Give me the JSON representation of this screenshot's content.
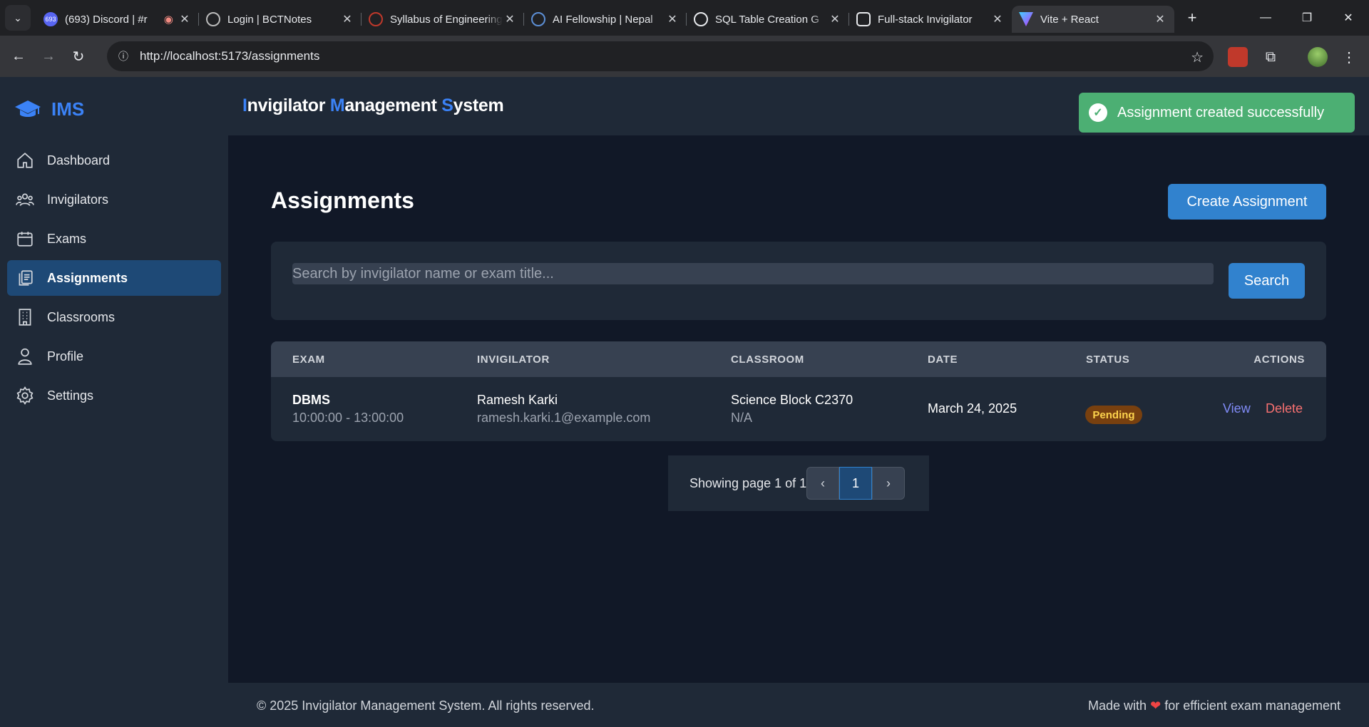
{
  "browser": {
    "tabs": [
      {
        "title": "(693) Discord | #r",
        "badge": "693",
        "active": false
      },
      {
        "title": "Login | BCTNotes",
        "active": false
      },
      {
        "title": "Syllabus of Engineering",
        "active": false
      },
      {
        "title": "AI Fellowship | Nepal",
        "active": false
      },
      {
        "title": "SQL Table Creation G",
        "active": false
      },
      {
        "title": "Full-stack Invigilator",
        "active": false
      },
      {
        "title": "Vite + React",
        "active": true
      }
    ],
    "url": "http://localhost:5173/assignments"
  },
  "sidebar": {
    "logo": "IMS",
    "items": [
      {
        "label": "Dashboard",
        "icon": "home-icon"
      },
      {
        "label": "Invigilators",
        "icon": "users-icon"
      },
      {
        "label": "Exams",
        "icon": "calendar-icon"
      },
      {
        "label": "Assignments",
        "icon": "clipboard-icon"
      },
      {
        "label": "Classrooms",
        "icon": "building-icon"
      },
      {
        "label": "Profile",
        "icon": "user-icon"
      },
      {
        "label": "Settings",
        "icon": "gear-icon"
      }
    ],
    "active_item": "Assignments"
  },
  "header": {
    "title_parts": [
      {
        "letter": "I",
        "rest": "nvigilator "
      },
      {
        "letter": "M",
        "rest": "anagement "
      },
      {
        "letter": "S",
        "rest": "ystem"
      }
    ]
  },
  "toast": {
    "message": "Assignment created successfully"
  },
  "page": {
    "title": "Assignments",
    "create_button": "Create Assignment",
    "search": {
      "placeholder": "Search by invigilator name or exam title...",
      "value": "",
      "button": "Search"
    }
  },
  "table": {
    "columns": [
      "EXAM",
      "INVIGILATOR",
      "CLASSROOM",
      "DATE",
      "STATUS",
      "ACTIONS"
    ],
    "rows": [
      {
        "exam": "DBMS",
        "time": "10:00:00 - 13:00:00",
        "invigilator": "Ramesh Karki",
        "email": "ramesh.karki.1@example.com",
        "classroom": "Science Block C2370",
        "classroom_sub": "N/A",
        "date": "March 24, 2025",
        "status": "Pending",
        "view": "View",
        "delete": "Delete"
      }
    ]
  },
  "pagination": {
    "text": "Showing page 1 of 1",
    "current": "1",
    "prev": "‹",
    "next": "›"
  },
  "footer": {
    "copyright": "© 2025 Invigilator Management System. All rights reserved.",
    "made_prefix": "Made with",
    "made_suffix": "for efficient exam management",
    "heart": "❤"
  },
  "colors": {
    "accent": "#3182ce",
    "brand": "#3b82f6",
    "success": "#4caf73",
    "danger": "#f87171",
    "link": "#818cf8"
  }
}
